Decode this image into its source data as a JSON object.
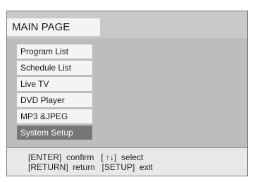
{
  "screen": {
    "title": "MAIN PAGE"
  },
  "menu": {
    "items": [
      {
        "label": "Program List",
        "selected": false
      },
      {
        "label": "Schedule List",
        "selected": false
      },
      {
        "label": "Live TV",
        "selected": false
      },
      {
        "label": "DVD Player",
        "selected": false
      },
      {
        "label": "MP3 &JPEG",
        "selected": false
      },
      {
        "label": "System Setup",
        "selected": true
      }
    ]
  },
  "footer": {
    "hint_line_1": "[ENTER]  confirm   [ ↑↓]  select",
    "hint_line_2": "[RETURN]  return   [SETUP]  exit"
  },
  "colors": {
    "screen_background": "#c9c9c9",
    "item_background": "#f4f4f4",
    "item_selected_background": "#767676",
    "footer_background": "#e8e8e8"
  }
}
